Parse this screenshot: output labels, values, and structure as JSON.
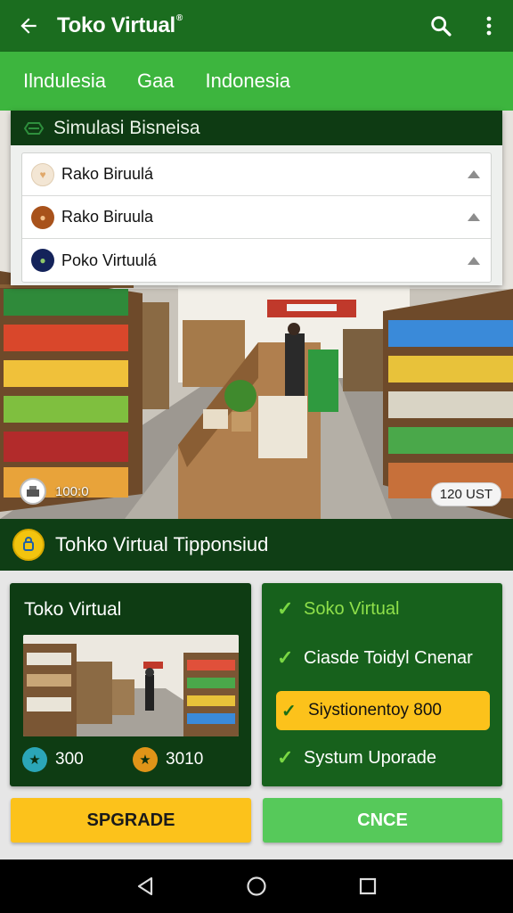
{
  "appbar": {
    "title": "Toko Virtual",
    "title_mark": "®"
  },
  "tabs": [
    "Ilndulesia",
    "Gaa",
    "Indonesia"
  ],
  "panel": {
    "title": "Simulasi Bisneisa",
    "items": [
      {
        "label": "Rako Biruulá",
        "avatar_color": "#f3e6d4"
      },
      {
        "label": "Rako Biruula",
        "avatar_color": "#a8521b"
      },
      {
        "label": "Poko Virtuulá",
        "avatar_color": "#14235a"
      }
    ]
  },
  "store": {
    "left_badge": "100:0",
    "right_badge": "120 UST"
  },
  "strip": {
    "title": "Tohko Virtual Tipponsiud"
  },
  "card_left": {
    "title": "Toko Virtual",
    "stats": [
      {
        "value": "300",
        "color": "#2ba6b8",
        "icon": "star-icon"
      },
      {
        "value": "3010",
        "color": "#e09418",
        "icon": "star-icon"
      }
    ]
  },
  "card_right": {
    "items": [
      "Soko Virtual",
      "Ciasde Toidyl Cnenar",
      "Siystionentoy 800",
      "Systum Uporade"
    ]
  },
  "buttons": {
    "upgrade": "SPGRADE",
    "cancel": "CNCE"
  },
  "colors": {
    "appbar": "#1b6d1f",
    "tabs": "#3db53e",
    "dark_green": "#0e3c13",
    "yellow": "#fcc21b",
    "light_green": "#56c95a"
  }
}
